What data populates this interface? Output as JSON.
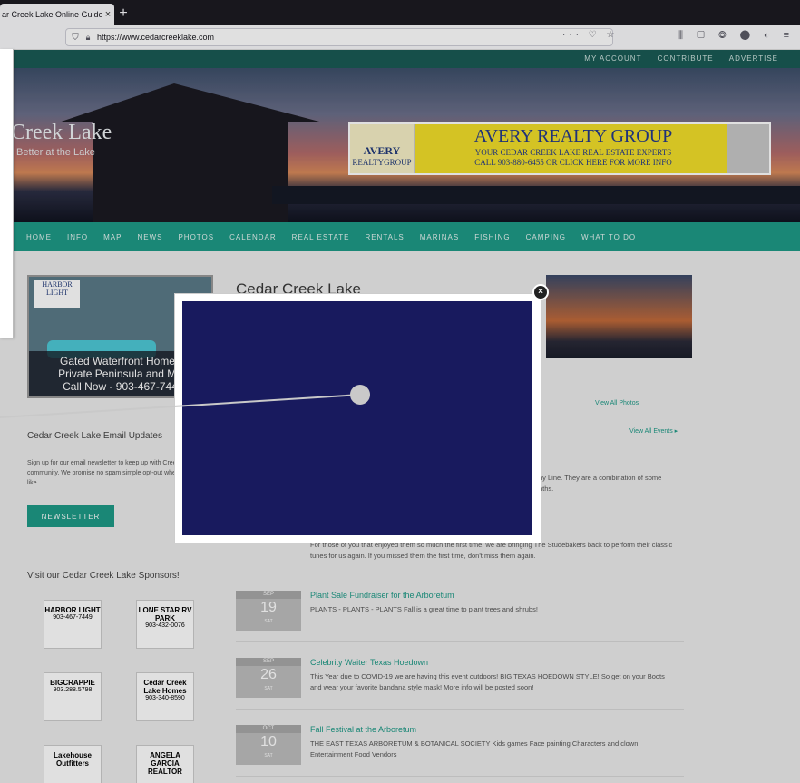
{
  "browser": {
    "tab_title": "ar Creek Lake Online Guide",
    "tab_close": "×",
    "new_tab": "+",
    "url": "https://www.cedarcreeklake.com",
    "url_actions": "··· ♡ ☆",
    "toolbar_icons": "⫼ ▢ ◎ ⬤ ◐ ≡"
  },
  "site": {
    "top_nav": [
      "MY ACCOUNT",
      "CONTRIBUTE",
      "ADVERTISE"
    ],
    "title": "Creek Lake",
    "tagline": "Better at the Lake",
    "ad": {
      "logo_name": "AVERY",
      "logo_sub": "REALTYGROUP",
      "title": "AVERY REALTY GROUP",
      "line1": "YOUR CEDAR CREEK LAKE REAL ESTATE EXPERTS",
      "line2": "CALL 903-880-6455 OR CLICK HERE FOR MORE INFO"
    },
    "main_nav": [
      "HOME",
      "INFO",
      "MAP",
      "NEWS",
      "PHOTOS",
      "CALENDAR",
      "REAL ESTATE",
      "RENTALS",
      "MARINAS",
      "FISHING",
      "CAMPING",
      "WHAT TO DO"
    ]
  },
  "sidebar": {
    "ad_brand": "HARBOR LIGHT",
    "ad_caption": [
      "Gated Waterfront Homes",
      "Private Peninsula and Ma",
      "Call Now - 903-467-744"
    ],
    "email_heading": "Cedar Creek Lake Email Updates",
    "email_body": "Sign up for our email newsletter to keep up with Creek Lake community. We promise no spam simple opt-out whenever you like.",
    "newsletter_button": "NEWSLETTER",
    "sponsors_heading": "Visit our Cedar Creek Lake Sponsors!",
    "sponsors": [
      {
        "name": "HARBOR LIGHT",
        "detail": "903-467-7449"
      },
      {
        "name": "LONE STAR RV PARK",
        "detail": "903-432-0076"
      },
      {
        "name": "BIGCRAPPIE",
        "detail": "903.288.5798"
      },
      {
        "name": "Cedar Creek Lake Homes",
        "detail": "903-340-8590"
      },
      {
        "name": "Lakehouse Outfitters",
        "detail": ""
      },
      {
        "name": "ANGELA GARCIA REALTOR",
        "detail": ""
      }
    ]
  },
  "main": {
    "title": "Cedar Creek Lake",
    "view_all_photos": "View All Photos",
    "view_all_events": "View All Events ▸",
    "fragment_1": "ny Line. They are a combination of some",
    "fragment_2": "nths.",
    "fragment_3": "For those of you that enjoyed them so much the first time, we are bringing The Studebakers back to perform their classic tunes for us again. If you missed them the first time, don't miss them again.",
    "events": [
      {
        "month": "SEP",
        "day": "19",
        "weekday": "SAT",
        "title": "Plant Sale Fundraiser for the Arboretum",
        "desc": "PLANTS - PLANTS - PLANTS Fall is a great time to plant trees and shrubs!"
      },
      {
        "month": "SEP",
        "day": "26",
        "weekday": "SAT",
        "title": "Celebrity Waiter Texas Hoedown",
        "desc": "This Year due to COVID-19 we are having this event outdoors! BIG TEXAS HOEDOWN STYLE! So get on your Boots and wear your favorite bandana style mask! More info will be posted soon!"
      },
      {
        "month": "OCT",
        "day": "10",
        "weekday": "SAT",
        "title": "Fall Festival at the Arboretum",
        "desc": "THE EAST TEXAS ARBORETUM & BOTANICAL SOCIETY Kids games Face painting Characters and clown Entertainment Food Vendors"
      }
    ]
  },
  "modal": {
    "close": "×",
    "video_color": "#181a5e"
  }
}
